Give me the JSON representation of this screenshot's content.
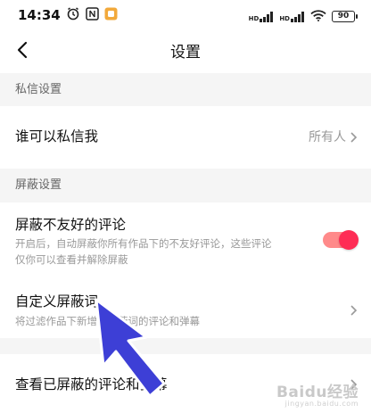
{
  "status_bar": {
    "time": "14:34",
    "battery": "90",
    "network_label": "HD",
    "icons": [
      "alarm-icon",
      "nfc-icon",
      "app-notification-icon",
      "signal-icon",
      "wifi-icon",
      "battery-icon"
    ]
  },
  "nav": {
    "title": "设置",
    "back_icon": "back-arrow-icon"
  },
  "sections": {
    "private_message": {
      "header": "私信设置",
      "who_can_message_label": "谁可以私信我",
      "who_can_message_value": "所有人"
    },
    "block": {
      "header": "屏蔽设置",
      "block_unfriendly_label": "屏蔽不友好的评论",
      "block_unfriendly_desc_line1": "开启后，自动屏蔽你所有作品下的不友好评论，这些评论",
      "block_unfriendly_desc_line2": "仅你可以查看并解除屏蔽",
      "block_unfriendly_enabled": true,
      "custom_words_label": "自定义屏蔽词",
      "custom_words_desc": "将过滤作品下新增含屏蔽词的评论和弹幕",
      "view_blocked_label": "查看已屏蔽的评论和弹幕"
    }
  },
  "colors": {
    "accent": "#fe2c55",
    "toggle_track": "#ff8a8a",
    "section_bg": "#f5f5f5",
    "annotation_arrow": "#3d3fd6"
  },
  "watermark": {
    "text": "Baidu经验",
    "sub": "jingyan.baidu.com"
  }
}
